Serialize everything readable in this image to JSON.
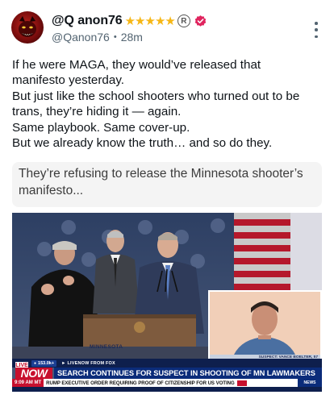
{
  "author": {
    "display_name": "@Q anon76",
    "stars": "★★★★★",
    "registered_mark": "R",
    "handle": "@Qanon76",
    "timestamp": "28m",
    "separator": "•"
  },
  "post": {
    "lines": [
      "If he were MAGA, they would’ve released that",
      "manifesto yesterday.",
      "But just like the school shooters who turned out to be",
      "trans, they’re hiding it — again.",
      "Same playbook. Same cover-up.",
      "But we already know the truth… and so do they."
    ]
  },
  "quoted_post": {
    "lines": [
      "They’re refusing to release the Minnesota shooter’s",
      "manifesto..."
    ]
  },
  "media": {
    "location_tag": "MINNESOTA",
    "suspect_caption": "SUSPECT: VANCE BOELTER, 57",
    "viewer_count": "153.0k+",
    "livenow_from": "► LIVENOW FROM FOX",
    "logo_live": "LIVE",
    "logo_now": "NOW",
    "headline": "SEARCH CONTINUES FOR SUSPECT IN SHOOTING OF MN LAWMAKERS",
    "ticker_time": "9:09 AM MT",
    "ticker_text": "RUMP EXECUTIVE ORDER REQUIRING PROOF OF CITIZENSHIP FOR US VOTING",
    "ticker_news_label": "NEWS"
  },
  "colors": {
    "stars": "#f6b716",
    "verified_badge": "#e0245e",
    "headline_bar": "#0b2c7a",
    "live_red": "#c8102e"
  },
  "icons": {
    "verified": "verified-badge-icon",
    "more": "more-options-icon",
    "registered": "registered-mark-icon"
  }
}
